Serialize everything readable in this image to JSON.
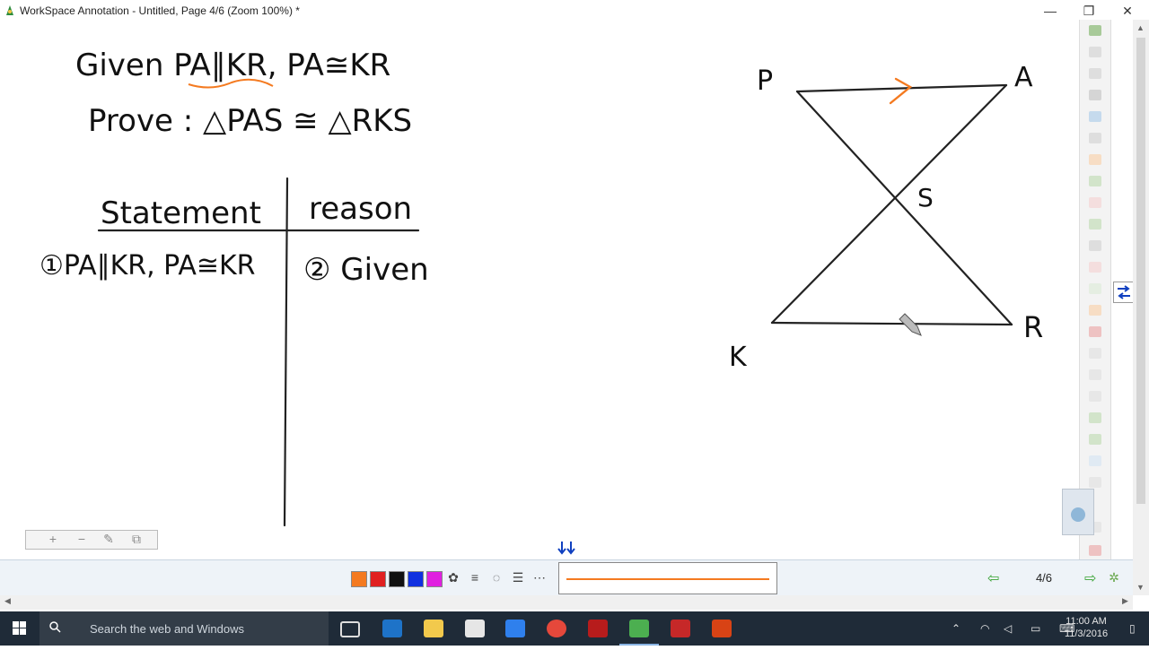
{
  "window": {
    "title": "WorkSpace Annotation - Untitled, Page 4/6 (Zoom 100%) *",
    "minimize_glyph": "—",
    "restore_glyph": "❐",
    "close_glyph": "✕"
  },
  "canvas": {
    "given_text": "Given PA∥KR, PA≅KR",
    "prove_text": "Prove : △PAS ≅ △RKS",
    "table": {
      "header_left": "Statement",
      "header_right": "reason",
      "rows": [
        {
          "statement": "①PA∥KR, PA≅KR",
          "reason": "② Given"
        }
      ]
    },
    "diagram_labels": {
      "p": "P",
      "a": "A",
      "s": "S",
      "k": "K",
      "r": "R"
    }
  },
  "zoom_controls": {
    "plus": "+",
    "minus": "−",
    "pen": "✎",
    "copy": "⧉"
  },
  "bottombar": {
    "colors": [
      "#f47a20",
      "#e02020",
      "#111111",
      "#1030e0",
      "#e020e0"
    ],
    "page_indicator": "4/6",
    "prev_glyph": "⇦",
    "next_glyph": "⇨"
  },
  "taskbar": {
    "search_placeholder": "Search the web and Windows",
    "time": "11:00 AM",
    "date": "11/3/2016"
  }
}
